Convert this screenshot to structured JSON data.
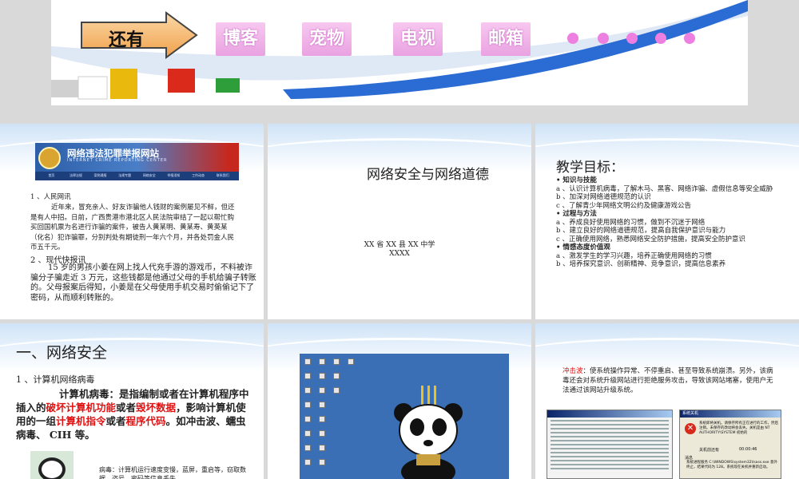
{
  "banner": {
    "arrow_label": "还有",
    "pills": [
      "博客",
      "宠物",
      "电视",
      "邮箱"
    ],
    "colors": {
      "pill": "#ec9fe3",
      "dot": "#ec7fe0",
      "swoosh_blue": "#2a6bd4"
    }
  },
  "slide1": {
    "site": {
      "title": "网络违法犯罪举报网站",
      "subtitle": "INTERNET CRIME REPORTING CENTER",
      "nav": [
        "首页",
        "法律法规",
        "案例通报",
        "法规专题",
        "网络安全",
        "举报须知",
        "工作动态",
        "联系我们"
      ]
    },
    "item1_heading": "1 、人民网讯",
    "item1_text": "近年来，冒充亲人、好友诈骗他人钱财的案例屡见不鲜，但还是有人中招。日前，广西贵港市港北区人民法院审结了一起以帮忙购买回国机票为名进行诈骗的案件，被告人黄某明、黄某寿、黄英某（化名）犯诈骗罪，分别判处有期徒刑一年六个月，并各处罚金人民币五千元。",
    "item2_heading": "2 、现代快报讯",
    "item2_text": "15 岁的男孩小姜在网上找人代充手游的游戏币，不料被诈骗分子骗走近 3 万元，这些钱都是他通过父母的手机给骗子转账的。父母报案后得知，小姜是在父母使用手机交易时偷偷记下了密码，从而顺利转账的。"
  },
  "slide2": {
    "title": "网络安全与网络道德",
    "school": "XX 省 XX 县 XX 中学",
    "name": "XXXX"
  },
  "slide3": {
    "title": "教学目标：",
    "sections": [
      {
        "heading": "知识与技能",
        "items": [
          "a 、认识计算机病毒，了解木马、黑客、网络诈骗、虚假信息等安全威胁",
          "b 、加深对网络道德规范的认识",
          "c 、了解青少年网络文明公约及健康游戏公告"
        ]
      },
      {
        "heading": "过程与方法",
        "items": [
          "a 、养成良好使用网络的习惯，做到不沉迷于网络",
          "b 、建立良好的网络道德规范，提高自我保护意识与能力",
          "c 、正确使用网络，熟悉网络安全防护措施，提高安全防护意识"
        ]
      },
      {
        "heading": "情感态度价值观",
        "items": [
          "a 、激发学生的学习兴趣，培养正确使用网络的习惯",
          "b 、培养探究意识、创新精神、竞争意识，提高信息素养"
        ]
      }
    ]
  },
  "slide4": {
    "title": "一、网络安全",
    "sub": "1 、计算机网络病毒",
    "def_part1": "计算机病毒：是指编制或者在计算机程序中插入的",
    "def_red1": "破坏计算机功能",
    "def_part2": "或者",
    "def_red2": "毁坏数据",
    "def_part3": "，影响计算机使用的一组",
    "def_red3": "计算机指令",
    "def_part4": "或者",
    "def_red4": "程序代码",
    "def_part5": "。如冲击波、蠕虫病毒、 CIH 等。",
    "note": "病毒：计算机运行速度变慢，蓝屏，重启等，窃取数据，盗号，密码等信息丢失"
  },
  "slide6": {
    "label": "冲击波",
    "text": "：使系统操作异常、不停重启、甚至导致系统崩溃。另外，该病毒还会对系统升级网站进行拒绝服务攻击，导致该网站堵塞，使用户无法通过该网站升级系统。",
    "dialog_title": "系统关机",
    "dialog_text": "系统即将关机。请保存所有正在进行的工作，然后注销。未保存的改动将会丢失。关机是由 NT AUTHORITY\\SYSTEM 初始的",
    "countdown_label": "关机前还有",
    "countdown": "00:00:46",
    "msg_label": "消息",
    "msg_text": "系统进程服务 C:\\WINDOWS\\system32\\lsass.exe 意外终止，结果代码为 128。系统现在关机并重新启动。"
  }
}
